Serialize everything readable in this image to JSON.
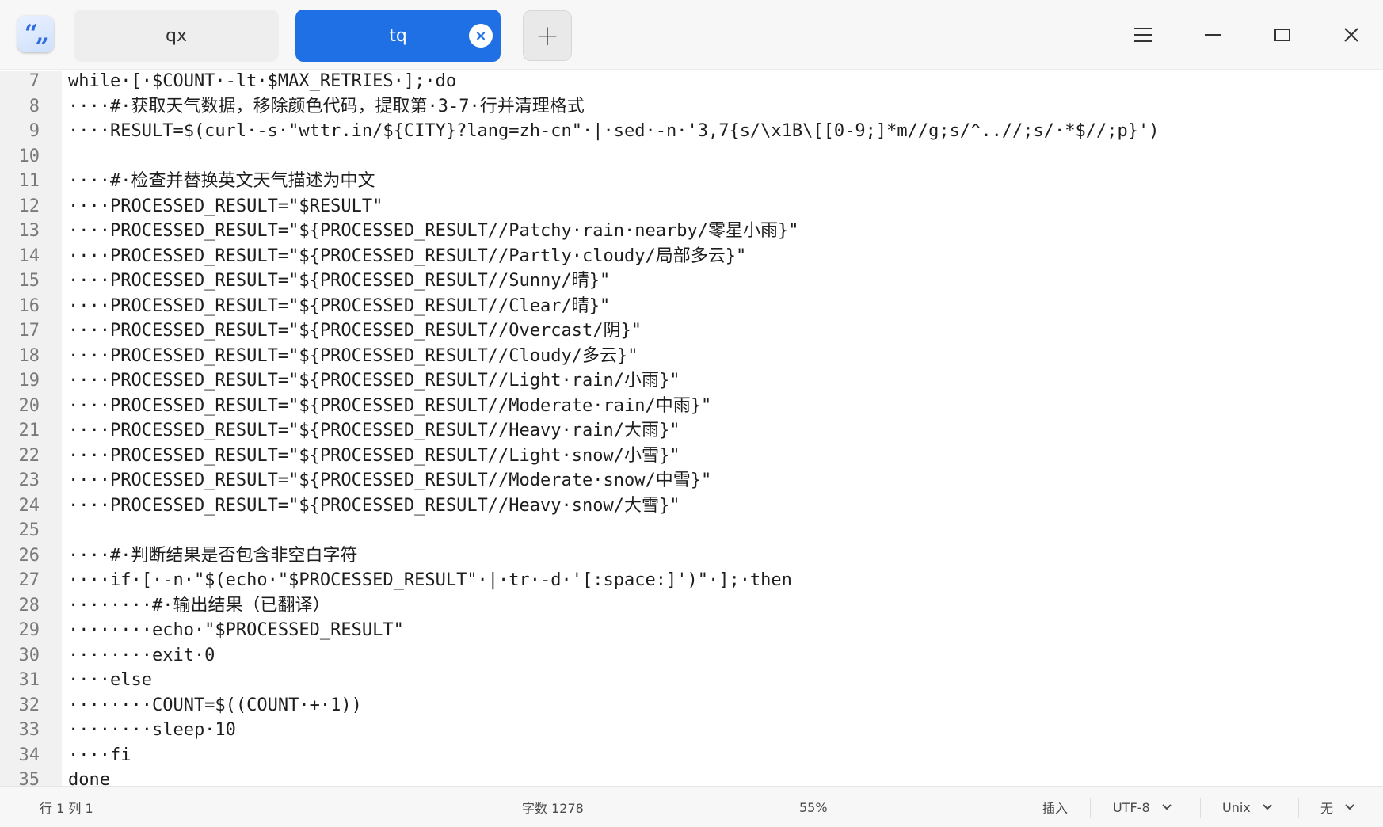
{
  "app": {
    "icon": "text-editor-quote-icon",
    "icon_glyph": "“„"
  },
  "tabs": [
    {
      "label": "qx",
      "active": false
    },
    {
      "label": "tq",
      "active": true,
      "close_glyph": "×"
    }
  ],
  "titlebar": {
    "new_tab_glyph": "+",
    "buttons": [
      "menu-icon",
      "minimize-icon",
      "maximize-icon",
      "close-icon"
    ]
  },
  "editor": {
    "lines": [
      {
        "no": "7",
        "text": "while·[·$COUNT·-lt·$MAX_RETRIES·];·do"
      },
      {
        "no": "8",
        "text": "····#·获取天气数据，移除颜色代码，提取第·3-7·行并清理格式"
      },
      {
        "no": "9",
        "text": "····RESULT=$(curl·-s·\"wttr.in/${CITY}?lang=zh-cn\"·|·sed·-n·'3,7{s/\\x1B\\[[0-9;]*m//g;s/^..//;s/·*$//;p}')"
      },
      {
        "no": "10",
        "text": ""
      },
      {
        "no": "11",
        "text": "····#·检查并替换英文天气描述为中文"
      },
      {
        "no": "12",
        "text": "····PROCESSED_RESULT=\"$RESULT\""
      },
      {
        "no": "13",
        "text": "····PROCESSED_RESULT=\"${PROCESSED_RESULT//Patchy·rain·nearby/零星小雨}\""
      },
      {
        "no": "14",
        "text": "····PROCESSED_RESULT=\"${PROCESSED_RESULT//Partly·cloudy/局部多云}\""
      },
      {
        "no": "15",
        "text": "····PROCESSED_RESULT=\"${PROCESSED_RESULT//Sunny/晴}\""
      },
      {
        "no": "16",
        "text": "····PROCESSED_RESULT=\"${PROCESSED_RESULT//Clear/晴}\""
      },
      {
        "no": "17",
        "text": "····PROCESSED_RESULT=\"${PROCESSED_RESULT//Overcast/阴}\""
      },
      {
        "no": "18",
        "text": "····PROCESSED_RESULT=\"${PROCESSED_RESULT//Cloudy/多云}\""
      },
      {
        "no": "19",
        "text": "····PROCESSED_RESULT=\"${PROCESSED_RESULT//Light·rain/小雨}\""
      },
      {
        "no": "20",
        "text": "····PROCESSED_RESULT=\"${PROCESSED_RESULT//Moderate·rain/中雨}\""
      },
      {
        "no": "21",
        "text": "····PROCESSED_RESULT=\"${PROCESSED_RESULT//Heavy·rain/大雨}\""
      },
      {
        "no": "22",
        "text": "····PROCESSED_RESULT=\"${PROCESSED_RESULT//Light·snow/小雪}\""
      },
      {
        "no": "23",
        "text": "····PROCESSED_RESULT=\"${PROCESSED_RESULT//Moderate·snow/中雪}\""
      },
      {
        "no": "24",
        "text": "····PROCESSED_RESULT=\"${PROCESSED_RESULT//Heavy·snow/大雪}\""
      },
      {
        "no": "25",
        "text": ""
      },
      {
        "no": "26",
        "text": "····#·判断结果是否包含非空白字符"
      },
      {
        "no": "27",
        "text": "····if·[·-n·\"$(echo·\"$PROCESSED_RESULT\"·|·tr·-d·'[:space:]')\"·];·then"
      },
      {
        "no": "28",
        "text": "········#·输出结果（已翻译）"
      },
      {
        "no": "29",
        "text": "········echo·\"$PROCESSED_RESULT\""
      },
      {
        "no": "30",
        "text": "········exit·0"
      },
      {
        "no": "31",
        "text": "····else"
      },
      {
        "no": "32",
        "text": "········COUNT=$((COUNT·+·1))"
      },
      {
        "no": "33",
        "text": "········sleep·10"
      },
      {
        "no": "34",
        "text": "····fi"
      },
      {
        "no": "35",
        "text": "done"
      }
    ]
  },
  "statusbar": {
    "cursor": "行 1  列 1",
    "char_count": "字数 1278",
    "zoom": "55%",
    "insert_mode": "插入",
    "encoding": "UTF-8",
    "line_ending": "Unix",
    "syntax": "无"
  },
  "colors": {
    "accent": "#1f6fe5",
    "titlebar_bg": "#f7f7f7",
    "gutter_bg": "#f1f1f1",
    "text": "#1e1e1e",
    "line_number": "#7a7a7a"
  }
}
